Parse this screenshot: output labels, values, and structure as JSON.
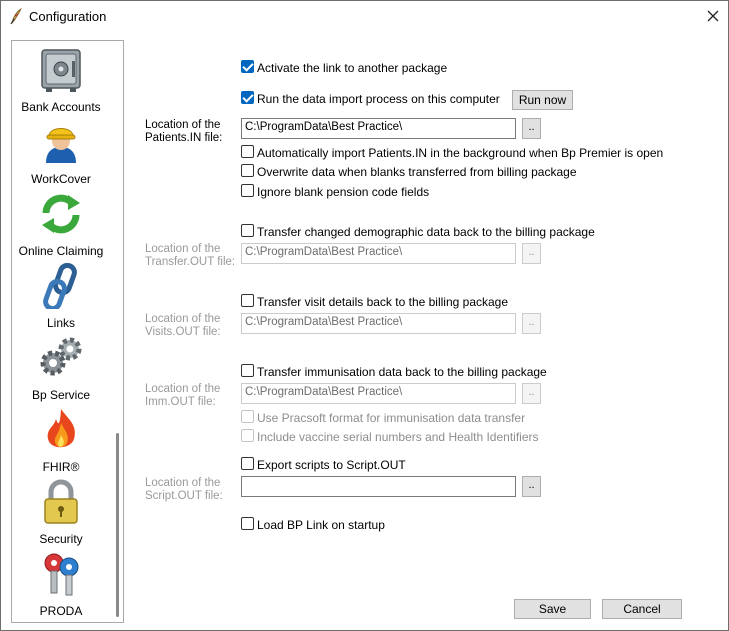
{
  "window": {
    "title": "Configuration"
  },
  "sidebar": {
    "items": [
      {
        "label": "Bank Accounts"
      },
      {
        "label": "WorkCover"
      },
      {
        "label": "Online Claiming"
      },
      {
        "label": "Links"
      },
      {
        "label": "Bp Service"
      },
      {
        "label": "FHIR®"
      },
      {
        "label": "Security"
      },
      {
        "label": "PRODA"
      }
    ]
  },
  "main": {
    "activate_link": {
      "label": "Activate the link to another package",
      "checked": true
    },
    "run_import": {
      "label": "Run the data import process on this computer",
      "checked": true
    },
    "run_now_button": "Run now",
    "patients_in": {
      "label_line1": "Location of the",
      "label_line2": "Patients.IN file:",
      "path": "C:\\ProgramData\\Best Practice\\",
      "browse": ".."
    },
    "auto_import": {
      "label": "Automatically import Patients.IN in the background when Bp Premier is open",
      "checked": false
    },
    "overwrite_blanks": {
      "label": "Overwrite data when blanks transferred from billing package",
      "checked": false
    },
    "ignore_pension": {
      "label": "Ignore blank pension code fields",
      "checked": false
    },
    "transfer_demographic": {
      "label": "Transfer changed demographic data back to the billing package",
      "checked": false
    },
    "transfer_out": {
      "label_line1": "Location of the",
      "label_line2": "Transfer.OUT file:",
      "path": "C:\\ProgramData\\Best Practice\\",
      "browse": ".."
    },
    "transfer_visits": {
      "label": "Transfer visit details back to the billing package",
      "checked": false
    },
    "visits_out": {
      "label_line1": "Location of the",
      "label_line2": "Visits.OUT file:",
      "path": "C:\\ProgramData\\Best Practice\\",
      "browse": ".."
    },
    "transfer_immunisation": {
      "label": "Transfer immunisation data back to the billing package",
      "checked": false
    },
    "imm_out": {
      "label_line1": "Location of the",
      "label_line2": "Imm.OUT file:",
      "path": "C:\\ProgramData\\Best Practice\\",
      "browse": ".."
    },
    "pracsoft_format": {
      "label": "Use Pracsoft format for immunisation data transfer",
      "checked": false
    },
    "include_vaccine": {
      "label": "Include vaccine serial numbers and Health Identifiers",
      "checked": false
    },
    "export_scripts": {
      "label": "Export scripts to Script.OUT",
      "checked": false
    },
    "script_out": {
      "label_line1": "Location of the",
      "label_line2": "Script.OUT file:",
      "path": "",
      "browse": ".."
    },
    "load_on_startup": {
      "label": "Load BP Link on startup",
      "checked": false
    }
  },
  "footer": {
    "save_label": "Save",
    "cancel_label": "Cancel"
  },
  "colors": {
    "accent": "#0067c0",
    "disabled_text": "#8d8d8d"
  }
}
